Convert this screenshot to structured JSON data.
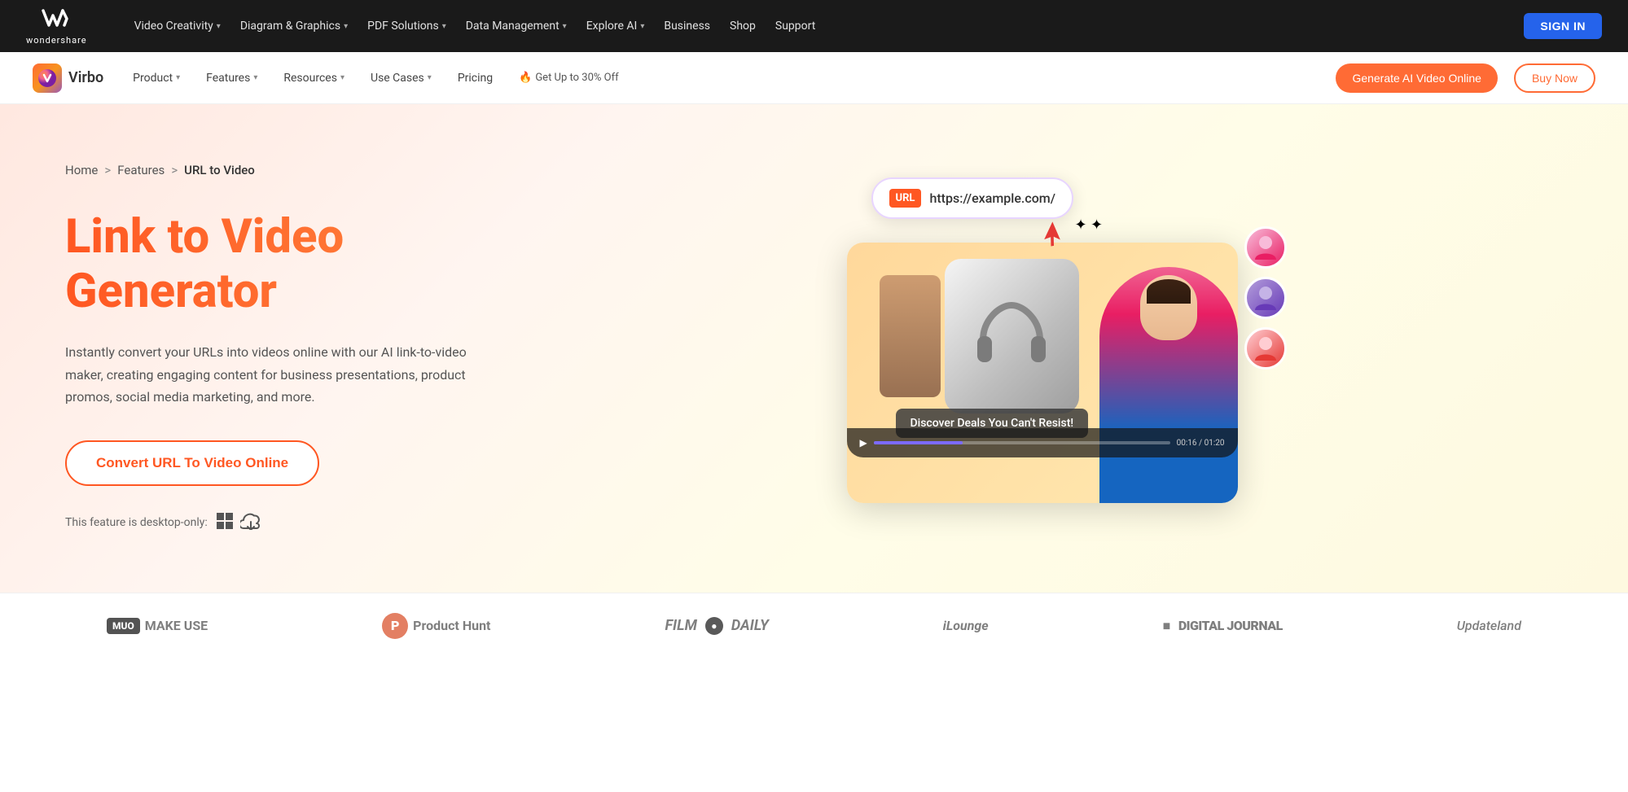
{
  "topNav": {
    "logo": "W",
    "logoSub": "wondershare",
    "items": [
      {
        "label": "Video Creativity",
        "hasDropdown": true
      },
      {
        "label": "Diagram & Graphics",
        "hasDropdown": true
      },
      {
        "label": "PDF Solutions",
        "hasDropdown": true
      },
      {
        "label": "Data Management",
        "hasDropdown": true
      },
      {
        "label": "Explore AI",
        "hasDropdown": true
      },
      {
        "label": "Business",
        "hasDropdown": false
      },
      {
        "label": "Shop",
        "hasDropdown": false
      },
      {
        "label": "Support",
        "hasDropdown": false
      }
    ],
    "signIn": "SIGN IN"
  },
  "productNav": {
    "brand": "Virbo",
    "items": [
      {
        "label": "Product",
        "hasDropdown": true
      },
      {
        "label": "Features",
        "hasDropdown": true
      },
      {
        "label": "Resources",
        "hasDropdown": true
      },
      {
        "label": "Use Cases",
        "hasDropdown": true
      },
      {
        "label": "Pricing",
        "hasDropdown": false
      }
    ],
    "promo": "🔥 Get Up to 30% Off",
    "generateBtn": "Generate AI Video Online",
    "buyNowBtn": "Buy Now"
  },
  "hero": {
    "breadcrumb": {
      "home": "Home",
      "sep1": ">",
      "features": "Features",
      "sep2": ">",
      "current": "URL to Video"
    },
    "title": "Link to Video Generator",
    "subtitle": "Instantly convert your URLs into videos online with our AI link-to-video maker, creating engaging content for business presentations, product promos, social media marketing, and more.",
    "convertBtn": "Convert URL To Video Online",
    "desktopNote": "This feature is desktop-only:",
    "urlBadge": {
      "label": "URL",
      "url": "https://example.com/"
    },
    "videoCaption": "Discover Deals You Can't Resist!",
    "timeCode": "00:16 / 01:20"
  },
  "bottomBar": {
    "logos": [
      {
        "badge": "MUO",
        "text": "MAKE USE"
      },
      {
        "ph": "P",
        "text": "Product Hunt"
      },
      {
        "text": "FILM ● DAILY"
      },
      {
        "text": "iLounge"
      },
      {
        "text": "■ DIGITAL JOURNAL"
      },
      {
        "text": "Updateland"
      }
    ]
  }
}
